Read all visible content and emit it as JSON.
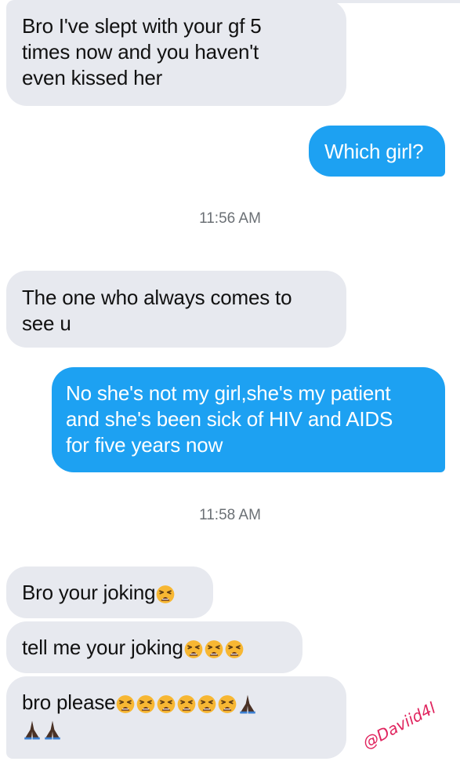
{
  "messages": [
    {
      "lines": [
        "Bro I've slept with your gf 5",
        "times now and you haven't",
        "even kissed her"
      ]
    },
    {
      "lines": [
        "Which girl?"
      ]
    },
    {
      "lines": [
        "The one who always comes to",
        "see u"
      ]
    },
    {
      "lines": [
        "No she's not my girl,she's my patient",
        "and she's been sick of HIV and AIDS",
        "for five years now"
      ]
    },
    {
      "lines": [
        "Bro your joking"
      ]
    },
    {
      "lines": [
        "tell me your joking"
      ]
    },
    {
      "lines": [
        "bro please"
      ]
    }
  ],
  "timestamps": [
    "11:56 AM",
    "11:58 AM"
  ],
  "watermark": "@Daviid4l",
  "emoji": {
    "tired": "tired-face-emoji",
    "pray": "folded-hands-emoji"
  },
  "colors": {
    "incoming_bubble": "#e7e9ef",
    "outgoing_bubble": "#1da1f2",
    "timestamp": "#6b7075",
    "watermark": "#e0245e"
  }
}
